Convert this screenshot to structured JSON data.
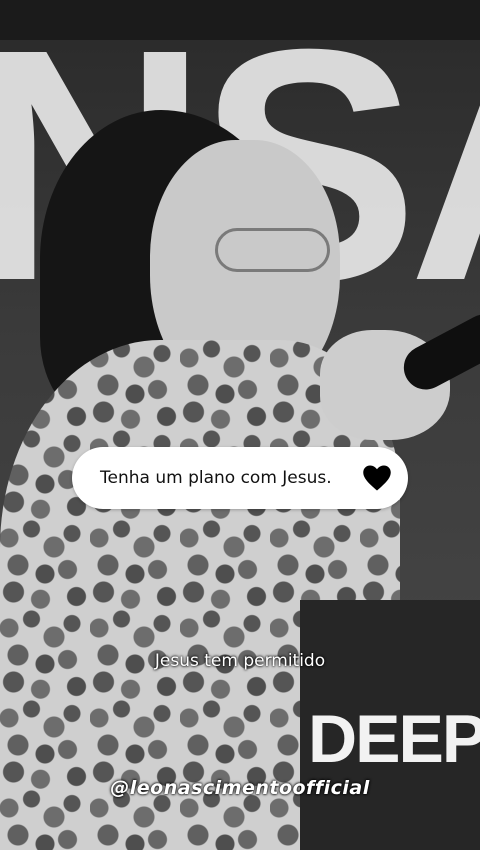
{
  "background": {
    "backdrop_letters": "NSA",
    "logo_text": "DEEP"
  },
  "caption_card": {
    "text": "Tenha um plano com Jesus.",
    "icon": "heart-icon",
    "icon_color": "#000000",
    "card_color": "#ffffff"
  },
  "subtitle": {
    "text": "Jesus tem permitido"
  },
  "watermark": {
    "handle": "@leonascimentoofficial"
  }
}
